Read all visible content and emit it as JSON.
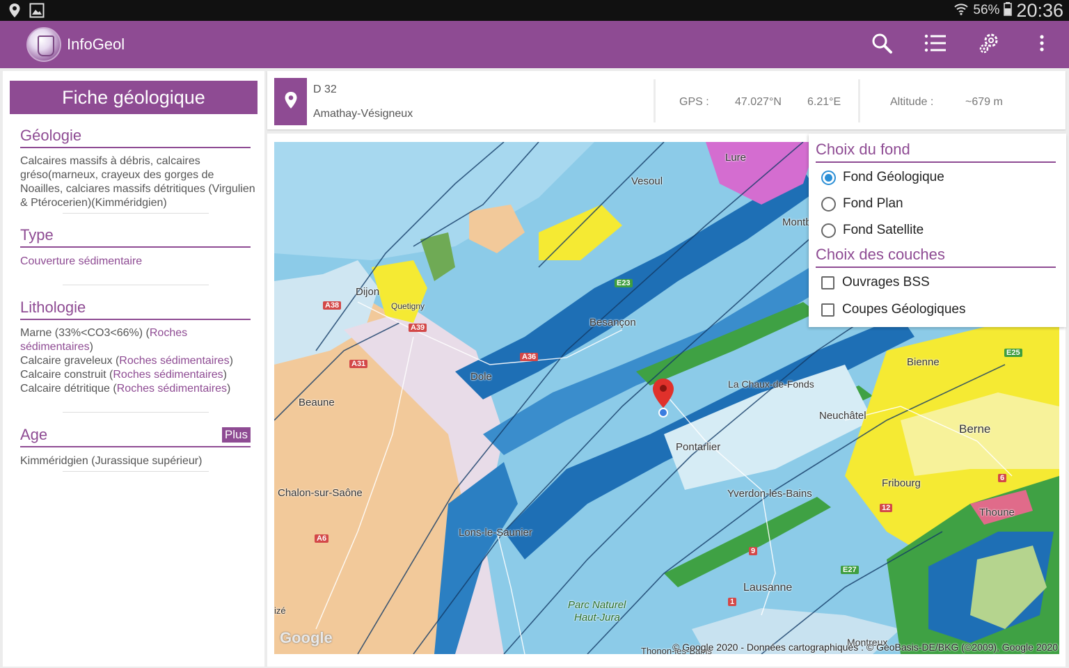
{
  "status_bar": {
    "battery": "56%",
    "time": "20:36"
  },
  "app": {
    "title": "InfoGeol",
    "brand_color": "#8e4b93"
  },
  "toolbar": {
    "icons": [
      "search-icon",
      "list-icon",
      "settings-icon",
      "overflow-menu-icon"
    ]
  },
  "fiche": {
    "title": "Fiche géologique",
    "geologie": {
      "title": "Géologie",
      "text": "Calcaires massifs à débris, calcaires gréso(marneux, crayeux des gorges de Noailles, calciares massifs détritiques (Virgulien & Ptérocerien)(Kimméridgien)"
    },
    "type": {
      "title": "Type",
      "value": "Couverture sédimentaire"
    },
    "lithologie": {
      "title": "Lithologie",
      "items": [
        {
          "name": "Marne (33%<CO3<66%) (",
          "link": "Roches sédimentaires",
          "end": ")"
        },
        {
          "name": "Calcaire graveleux (",
          "link": "Roches sédimentaires",
          "end": ")"
        },
        {
          "name": "Calcaire construit (",
          "link": "Roches sédimentaires",
          "end": ")"
        },
        {
          "name": "Calcaire détritique (",
          "link": "Roches sédimentaires",
          "end": ")"
        }
      ]
    },
    "age": {
      "title": "Age",
      "plus_label": "Plus",
      "value": "Kimméridgien (Jurassique supérieur)"
    }
  },
  "location": {
    "road": "D 32",
    "commune": "Amathay-Vésigneux",
    "gps_label": "GPS :",
    "lat": "47.027°N",
    "lon": "6.21°E",
    "altitude_label": "Altitude :",
    "altitude": "~679 m"
  },
  "map": {
    "cities": [
      {
        "name": "Lure",
        "key": "lure"
      },
      {
        "name": "Vesoul",
        "key": "vesoul"
      },
      {
        "name": "Montb",
        "key": "montb"
      },
      {
        "name": "Dijon",
        "key": "dijon"
      },
      {
        "name": "Quetigny",
        "key": "quetigny"
      },
      {
        "name": "Besançon",
        "key": "besancon"
      },
      {
        "name": "Dole",
        "key": "dole"
      },
      {
        "name": "Beaune",
        "key": "beaune"
      },
      {
        "name": "Bienne",
        "key": "bienne"
      },
      {
        "name": "La Chaux-de-Fonds",
        "key": "chaux"
      },
      {
        "name": "Neuchâtel",
        "key": "neuchatel"
      },
      {
        "name": "Berne",
        "key": "berne"
      },
      {
        "name": "Pontarlier",
        "key": "pontarlier"
      },
      {
        "name": "Fribourg",
        "key": "fribourg"
      },
      {
        "name": "Chalon-sur-Saône",
        "key": "chalon"
      },
      {
        "name": "Yverdon-les-Bains",
        "key": "yverdon"
      },
      {
        "name": "Thoune",
        "key": "thoune"
      },
      {
        "name": "Lons-le-Saunier",
        "key": "lons"
      },
      {
        "name": "Lausanne",
        "key": "lausanne"
      },
      {
        "name": "Parc Naturel",
        "key": "parc1"
      },
      {
        "name": "Haut-Jura",
        "key": "parc2"
      },
      {
        "name": "Montreux",
        "key": "montreux"
      },
      {
        "name": "Thonon-les-Bains",
        "key": "thonon"
      },
      {
        "name": "izé",
        "key": "ize"
      }
    ],
    "highways": [
      {
        "label": "A38",
        "key": "a38"
      },
      {
        "label": "A39",
        "key": "a39"
      },
      {
        "label": "A31",
        "key": "a31"
      },
      {
        "label": "A36",
        "key": "a36"
      },
      {
        "label": "A6",
        "key": "a6"
      },
      {
        "label": "9",
        "key": "h9"
      },
      {
        "label": "1",
        "key": "h1"
      },
      {
        "label": "12",
        "key": "h12"
      },
      {
        "label": "6",
        "key": "h6"
      }
    ],
    "euro_routes": [
      {
        "label": "E23",
        "key": "e23"
      },
      {
        "label": "E25",
        "key": "e25"
      },
      {
        "label": "E27",
        "key": "e27"
      }
    ],
    "google_logo": "Google",
    "copyright": "© Google 2020 - Données cartographiques : © GeoBasis-DE/BKG (©2009), Google 2020"
  },
  "layers": {
    "fond_title": "Choix du fond",
    "fond_options": [
      {
        "label": "Fond Géologique",
        "selected": true
      },
      {
        "label": "Fond Plan",
        "selected": false
      },
      {
        "label": "Fond Satellite",
        "selected": false
      }
    ],
    "couches_title": "Choix des couches",
    "couches_options": [
      {
        "label": "Ouvrages BSS",
        "checked": false
      },
      {
        "label": "Coupes Géologiques",
        "checked": false
      }
    ]
  }
}
